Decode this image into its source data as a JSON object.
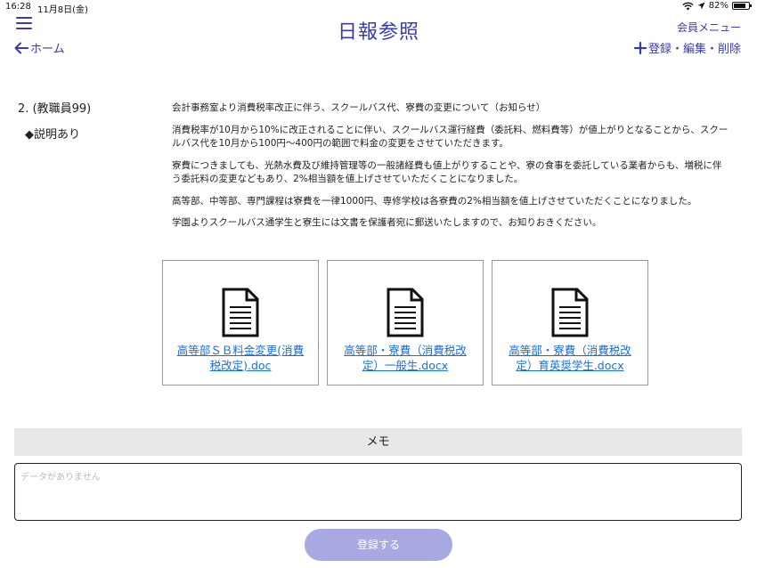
{
  "statusbar": {
    "time": "16:28",
    "date": "11月8日(金)",
    "battery_text": "82%",
    "battery_level": 0.82,
    "icons": [
      "wifi-icon",
      "location-icon",
      "battery-icon"
    ]
  },
  "header": {
    "title": "日報参照",
    "member_menu": "会員メニュー",
    "home_link": "ホーム",
    "register_link": "登録・編集・削除",
    "accent_color": "#3b3ca4"
  },
  "report": {
    "author": "2. (教職員99)",
    "status": "◆説明あり",
    "paragraphs": [
      "会計事務室より消費税率改正に伴う、スクールバス代、寮費の変更について（お知らせ）",
      "消費税率が10月から10%に改正されることに伴い、スクールバス運行経費（委託料、燃料費等）が値上がりとなることから、スクールバス代を10月から100円〜400円の範囲で料金の変更をさせていただきます。",
      "寮費につきましても、光熱水費及び維持管理等の一般諸経費も値上がりすることや、寮の食事を委託している業者からも、増税に伴う委託料の変更などもあり、2%相当額を値上げさせていただくことになりました。",
      "高等部、中等部、専門課程は寮費を一律1000円、専修学校は各寮費の2%相当額を値上げさせていただくことになりました。",
      "学園よりスクールバス通学生と寮生には文書を保護者宛に郵送いたしますので、お知りおきください。"
    ]
  },
  "attachments": [
    {
      "filename": "高等部ＳＢ料金変更(消費税改定).doc",
      "icon": "document-icon"
    },
    {
      "filename": "高等部・寮費（消費税改定）一般生.docx",
      "icon": "document-icon"
    },
    {
      "filename": "高等部・寮費（消費税改定）育英奨学生.docx",
      "icon": "document-icon"
    }
  ],
  "memo": {
    "label": "メモ",
    "placeholder": "データがありません"
  },
  "submit": {
    "label": "登録する",
    "color": "#a8a8e2"
  }
}
